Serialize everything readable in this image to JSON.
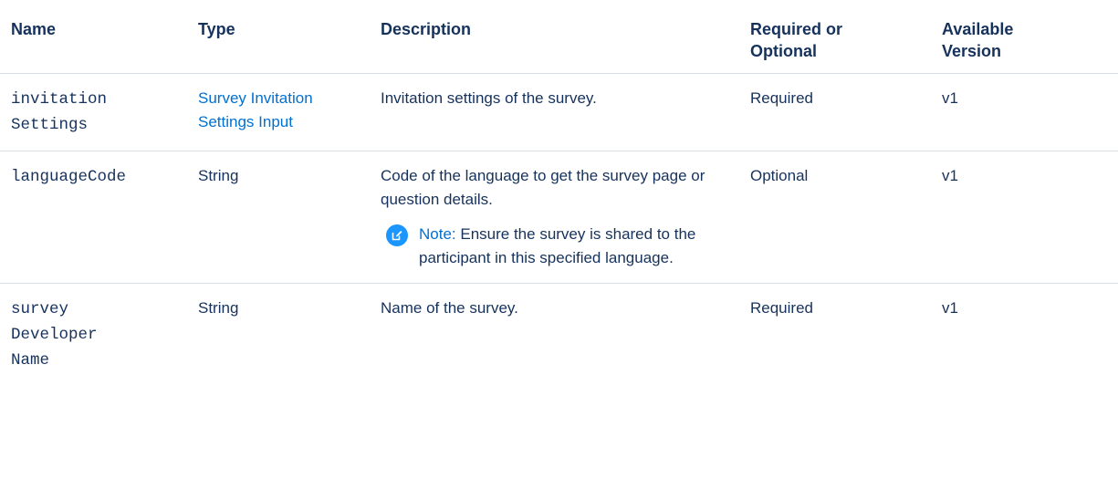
{
  "header": {
    "name": "Name",
    "type": "Type",
    "description": "Description",
    "required_line1": "Required or",
    "required_line2": "Optional",
    "version_line1": "Available",
    "version_line2": "Version"
  },
  "rows": [
    {
      "name_lines": [
        "invitation",
        "Settings"
      ],
      "type_lines": [
        "Survey Invitation",
        "Settings Input"
      ],
      "description": "Invitation settings of the survey.",
      "required": "Required",
      "version": "v1"
    },
    {
      "name_lines": [
        "languageCode"
      ],
      "type": "String",
      "description": "Code of the language to get the survey page or question details.",
      "note_label": "Note:",
      "note_text": "Ensure the survey is shared to the participant in this specified language.",
      "note_icon": "edit-note-icon",
      "required": "Optional",
      "version": "v1"
    },
    {
      "name_lines": [
        "survey",
        "Developer",
        "Name"
      ],
      "type": "String",
      "description": "Name of the survey.",
      "required": "Required",
      "version": "v1"
    }
  ],
  "colors": {
    "text": "#16325c",
    "link": "#0070d2",
    "note_icon_bg": "#1b96ff",
    "divider": "#d8dde6"
  }
}
